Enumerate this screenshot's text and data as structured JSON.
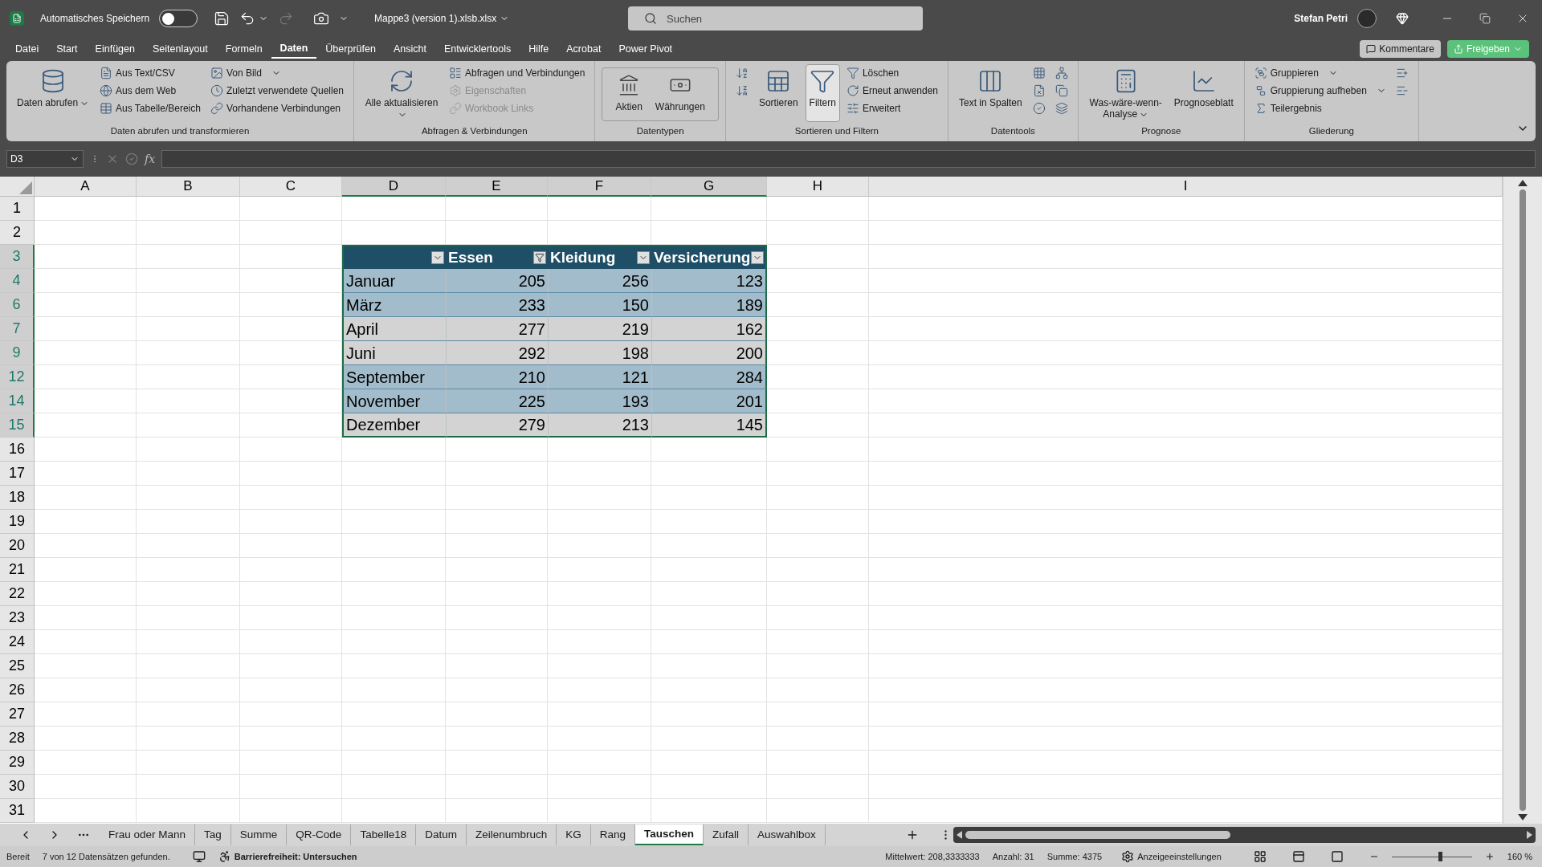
{
  "title_bar": {
    "autosave": {
      "label": "Automatisches Speichern",
      "on": false
    },
    "filename": "Mappe3 (version 1).xlsb.xlsx",
    "search_placeholder": "Suchen",
    "user": "Stefan Petri"
  },
  "menu": [
    {
      "label": "Datei",
      "selected": false
    },
    {
      "label": "Start",
      "selected": false
    },
    {
      "label": "Einfügen",
      "selected": false
    },
    {
      "label": "Seitenlayout",
      "selected": false
    },
    {
      "label": "Formeln",
      "selected": false
    },
    {
      "label": "Daten",
      "selected": true
    },
    {
      "label": "Überprüfen",
      "selected": false
    },
    {
      "label": "Ansicht",
      "selected": false
    },
    {
      "label": "Entwicklertools",
      "selected": false
    },
    {
      "label": "Hilfe",
      "selected": false
    },
    {
      "label": "Acrobat",
      "selected": false
    },
    {
      "label": "Power Pivot",
      "selected": false
    }
  ],
  "comment_button": "Kommentare",
  "share_button": "Freigeben",
  "ribbon": [
    {
      "label": "Daten abrufen und transformieren",
      "columns": [
        [
          {
            "kind": "large",
            "label": "Daten abrufen",
            "dropdown": true,
            "selected": false
          }
        ],
        [
          {
            "kind": "small",
            "label": "Aus Text/CSV",
            "disabled": false
          },
          {
            "kind": "small",
            "label": "Aus dem Web",
            "disabled": false
          },
          {
            "kind": "small",
            "label": "Aus Tabelle/Bereich",
            "disabled": false
          }
        ],
        [
          {
            "kind": "small",
            "label": "Von Bild",
            "dropdown": true,
            "disabled": false
          },
          {
            "kind": "small",
            "label": "Zuletzt verwendete Quellen",
            "disabled": false
          },
          {
            "kind": "small",
            "label": "Vorhandene Verbindungen",
            "disabled": false
          }
        ]
      ]
    },
    {
      "label": "Abfragen & Verbindungen",
      "columns": [
        [
          {
            "kind": "large",
            "label": "Alle aktualisieren",
            "dropdown": true,
            "selected": false
          }
        ],
        [
          {
            "kind": "small",
            "label": "Abfragen und Verbindungen",
            "disabled": false
          },
          {
            "kind": "small",
            "label": "Eigenschaften",
            "disabled": true
          },
          {
            "kind": "small",
            "label": "Workbook Links",
            "disabled": true
          }
        ]
      ]
    },
    {
      "label": "Datentypen",
      "columns": [
        [
          {
            "kind": "gallery",
            "label": "Aktien"
          },
          {
            "kind": "gallery",
            "label": "Währungen"
          }
        ]
      ]
    },
    {
      "label": "Sortieren und Filtern",
      "columns": [
        [
          {
            "kind": "icon"
          },
          {
            "kind": "icon"
          }
        ],
        [
          {
            "kind": "large",
            "label": "Sortieren",
            "selected": false
          }
        ],
        [
          {
            "kind": "large",
            "label": "Filtern",
            "selected": true
          }
        ],
        [
          {
            "kind": "small",
            "label": "Löschen",
            "disabled": false
          },
          {
            "kind": "small",
            "label": "Erneut anwenden",
            "disabled": false
          },
          {
            "kind": "small",
            "label": "Erweitert",
            "disabled": false
          }
        ]
      ]
    },
    {
      "label": "Datentools",
      "columns": [
        [
          {
            "kind": "large",
            "label": "Text in Spalten",
            "selected": false
          }
        ],
        [
          {
            "kind": "icon"
          },
          {
            "kind": "icon"
          },
          {
            "kind": "icon"
          }
        ],
        [
          {
            "kind": "icon"
          },
          {
            "kind": "icon"
          },
          {
            "kind": "icon"
          }
        ]
      ]
    },
    {
      "label": "Prognose",
      "columns": [
        [
          {
            "kind": "large",
            "label": "Was-wäre-wenn-Analyse",
            "dropdown": true,
            "selected": false
          }
        ],
        [
          {
            "kind": "large",
            "label": "Prognoseblatt",
            "selected": false
          }
        ]
      ]
    },
    {
      "label": "Gliederung",
      "columns": [
        [
          {
            "kind": "small",
            "label": "Gruppieren",
            "dropdown": true,
            "disabled": false
          },
          {
            "kind": "small",
            "label": "Gruppierung aufheben",
            "dropdown": true,
            "disabled": false
          },
          {
            "kind": "small",
            "label": "Teilergebnis",
            "disabled": false
          }
        ],
        [
          {
            "kind": "icon"
          },
          {
            "kind": "icon"
          }
        ]
      ]
    }
  ],
  "formula_bar": {
    "name_box": "D3",
    "function_label": "fx"
  },
  "columns": [
    {
      "label": "A",
      "selected": false
    },
    {
      "label": "B",
      "selected": false
    },
    {
      "label": "C",
      "selected": false
    },
    {
      "label": "D",
      "selected": true
    },
    {
      "label": "E",
      "selected": true
    },
    {
      "label": "F",
      "selected": true
    },
    {
      "label": "G",
      "selected": true
    },
    {
      "label": "H",
      "selected": false
    },
    {
      "label": "I",
      "selected": false
    }
  ],
  "rows": [
    {
      "label": "1",
      "selected": false
    },
    {
      "label": "2",
      "selected": false
    },
    {
      "label": "3",
      "selected": true
    },
    {
      "label": "4",
      "selected": true
    },
    {
      "label": "6",
      "selected": true
    },
    {
      "label": "7",
      "selected": true
    },
    {
      "label": "9",
      "selected": true
    },
    {
      "label": "12",
      "selected": true
    },
    {
      "label": "14",
      "selected": true
    },
    {
      "label": "15",
      "selected": true
    },
    {
      "label": "16",
      "selected": false
    },
    {
      "label": "17",
      "selected": false
    },
    {
      "label": "18",
      "selected": false
    },
    {
      "label": "19",
      "selected": false
    },
    {
      "label": "20",
      "selected": false
    },
    {
      "label": "21",
      "selected": false
    },
    {
      "label": "22",
      "selected": false
    },
    {
      "label": "23",
      "selected": false
    },
    {
      "label": "24",
      "selected": false
    },
    {
      "label": "25",
      "selected": false
    },
    {
      "label": "26",
      "selected": false
    },
    {
      "label": "27",
      "selected": false
    },
    {
      "label": "28",
      "selected": false
    },
    {
      "label": "29",
      "selected": false
    },
    {
      "label": "30",
      "selected": false
    },
    {
      "label": "31",
      "selected": false
    }
  ],
  "table": {
    "header": [
      {
        "filtered": false
      },
      {
        "label": "Essen",
        "filtered": true
      },
      {
        "label": "Kleidung",
        "filtered": false
      },
      {
        "label": "Versicherung",
        "filtered": false
      }
    ],
    "rows": [
      {
        "banded": true,
        "cells": [
          "Januar",
          "205",
          "256",
          "123"
        ]
      },
      {
        "banded": true,
        "cells": [
          "März",
          "233",
          "150",
          "189"
        ]
      },
      {
        "banded": false,
        "cells": [
          "April",
          "277",
          "219",
          "162"
        ]
      },
      {
        "banded": false,
        "cells": [
          "Juni",
          "292",
          "198",
          "200"
        ]
      },
      {
        "banded": true,
        "cells": [
          "September",
          "210",
          "121",
          "284"
        ]
      },
      {
        "banded": true,
        "cells": [
          "November",
          "225",
          "193",
          "201"
        ]
      },
      {
        "banded": false,
        "cells": [
          "Dezember",
          "279",
          "213",
          "145"
        ]
      }
    ]
  },
  "sheet_tabs": [
    {
      "label": "Frau oder Mann",
      "selected": false
    },
    {
      "label": "Tag",
      "selected": false
    },
    {
      "label": "Summe",
      "selected": false
    },
    {
      "label": "QR-Code",
      "selected": false
    },
    {
      "label": "Tabelle18",
      "selected": false
    },
    {
      "label": "Datum",
      "selected": false
    },
    {
      "label": "Zeilenumbruch",
      "selected": false
    },
    {
      "label": "KG",
      "selected": false
    },
    {
      "label": "Rang",
      "selected": false
    },
    {
      "label": "Tauschen",
      "selected": true
    },
    {
      "label": "Zufall",
      "selected": false
    },
    {
      "label": "Auswahlbox",
      "selected": false
    }
  ],
  "status_bar": {
    "mode": "Bereit",
    "filter_info": "7 von 12 Datensätzen gefunden.",
    "accessibility": "Barrierefreiheit: Untersuchen",
    "average": "Mittelwert: 208,3333333",
    "count": "Anzahl: 31",
    "sum": "Summe: 4375",
    "display_settings": "Anzeigeeinstellungen",
    "zoom": {
      "level": 0.6,
      "label": "160 %"
    }
  }
}
